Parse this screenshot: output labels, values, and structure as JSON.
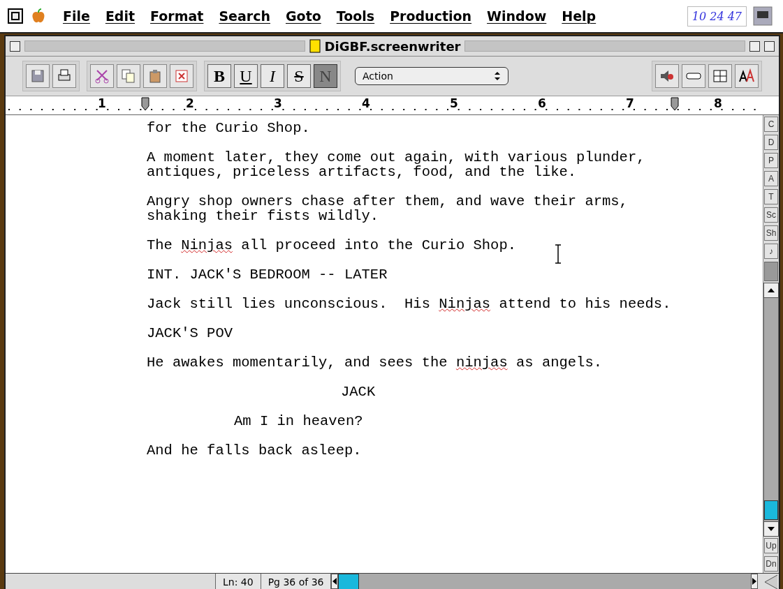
{
  "menubar": {
    "items": [
      "File",
      "Edit",
      "Format",
      "Search",
      "Goto",
      "Tools",
      "Production",
      "Window",
      "Help"
    ],
    "clock": "10 24 47"
  },
  "window": {
    "title": "DiGBF.screenwriter"
  },
  "toolbar": {
    "style_buttons": [
      {
        "label": "B",
        "selected": false
      },
      {
        "label": "U",
        "selected": false
      },
      {
        "label": "I",
        "selected": false
      },
      {
        "label": "S",
        "selected": false
      },
      {
        "label": "N",
        "selected": true
      }
    ],
    "element_select": "Action"
  },
  "ruler": {
    "numbers": [
      "1",
      "2",
      "3",
      "4",
      "5",
      "6",
      "7",
      "8"
    ]
  },
  "script": [
    {
      "kind": "action",
      "segments": [
        {
          "text": "for the Curio Shop."
        }
      ]
    },
    {
      "kind": "action",
      "segments": [
        {
          "text": "A moment later, they come out again, with various plunder,\nantiques, priceless artifacts, food, and the like."
        }
      ]
    },
    {
      "kind": "action",
      "segments": [
        {
          "text": "Angry shop owners chase after them, and wave their arms,\nshaking their fists wildly."
        }
      ]
    },
    {
      "kind": "action",
      "segments": [
        {
          "text": "The "
        },
        {
          "text": "Ninjas",
          "misspelled": true
        },
        {
          "text": " all proceed into the Curio Shop."
        }
      ]
    },
    {
      "kind": "scene_heading",
      "segments": [
        {
          "text": "INT. JACK'S BEDROOM -- LATER"
        }
      ]
    },
    {
      "kind": "action",
      "segments": [
        {
          "text": "Jack still lies unconscious.  His "
        },
        {
          "text": "Ninjas",
          "misspelled": true
        },
        {
          "text": " attend to his needs."
        }
      ]
    },
    {
      "kind": "shot",
      "segments": [
        {
          "text": "JACK'S POV"
        }
      ]
    },
    {
      "kind": "action",
      "segments": [
        {
          "text": "He awakes momentarily, and sees the "
        },
        {
          "text": "ninjas",
          "misspelled": true
        },
        {
          "text": " as angels."
        }
      ]
    },
    {
      "kind": "character",
      "segments": [
        {
          "text": "JACK"
        }
      ]
    },
    {
      "kind": "dialogue",
      "segments": [
        {
          "text": "Am I in heaven?"
        }
      ]
    },
    {
      "kind": "action",
      "segments": [
        {
          "text": "And he falls back asleep."
        }
      ]
    }
  ],
  "side_buttons": [
    "C",
    "D",
    "P",
    "A",
    "T",
    "Sc",
    "Sh",
    "♪"
  ],
  "scroll_buttons": [
    "Up",
    "Dn"
  ],
  "status_bar": {
    "line": "Ln:  40",
    "page": "Pg 36 of 36"
  }
}
